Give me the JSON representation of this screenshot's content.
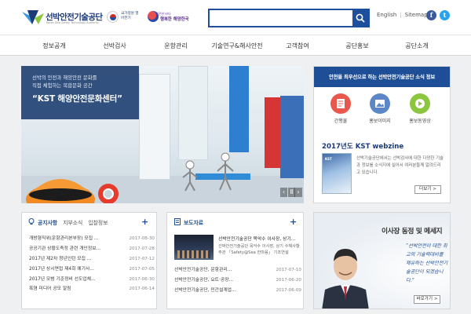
{
  "header": {
    "logo_title": "선박안전기술공단",
    "logo_subtitle": "Korea Ship Safety Technology Authority",
    "flag_text": "국가정원 열어한기",
    "slogan_small": "안전한 바다",
    "slogan_text": "행복한 해양한국",
    "search_placeholder": "",
    "utility": {
      "english": "English",
      "sitemap": "Sitemap"
    },
    "sns": {
      "facebook": "f",
      "twitter": "t"
    }
  },
  "nav": {
    "items": [
      "정보공개",
      "선박검사",
      "운항관리",
      "기술연구&해사안전",
      "고객참여",
      "공단홍보",
      "공단소개"
    ]
  },
  "hero": {
    "line1": "선박의 안전과 해양안전 문화를",
    "line2": "직접 체험하는 복합문화 공간",
    "title": "“KST 해양안전문화센터”",
    "controls": {
      "prev": "‹",
      "pause": "Ⅱ",
      "next": "›"
    }
  },
  "news_panel": {
    "heading": "안전을 최우선으로 하는 선박안전기술공단 소식 정보",
    "icons": [
      {
        "label": "간행물",
        "color": "#e8584c"
      },
      {
        "label": "홍보이미지",
        "color": "#5b86c8"
      },
      {
        "label": "홍보동영상",
        "color": "#8cc63f"
      }
    ],
    "webzine_title": "2017년도 KST webzine",
    "webzine_cover": "KST",
    "webzine_desc": "선박기술공단에서는 선박검사에 대한 다양한 기술과 정보를 소식지에 실어서 여러분들께 알려드리고 있습니다.",
    "more_label": "더보기 >"
  },
  "notice": {
    "tab_active": "공지사항",
    "tab_2": "지부소식",
    "tab_3": "입찰정보",
    "plus": "+",
    "items": [
      {
        "title": "개방형직위(운항관리본부장) 모집 ...",
        "date": "2017-08-30"
      },
      {
        "title": "공공기관 상황도측정 관련 개인정보...",
        "date": "2017-07-28"
      },
      {
        "title": "2017년 제2차 청년인턴 모집 ...",
        "date": "2017-07-12"
      },
      {
        "title": "2017년 상시면접 제4회 예기사...",
        "date": "2017-07-05"
      },
      {
        "title": "2017년 모범 기준정비 선도업체...",
        "date": "2017-06-30"
      },
      {
        "title": "폭염 미디어 공모 알림",
        "date": "2017-06-14"
      }
    ]
  },
  "press": {
    "tab_active": "보도자료",
    "plus": "+",
    "headline": "선박안전기술공단 목악수 이사장, 상기...",
    "desc": "선박안전기술공단 목악수 이사장, 상기 수해사항 주관 「Safety@Sea 한마음」 기조연설",
    "items": [
      {
        "title": "선박안전기술공단, 운항관리...",
        "date": "2017-07-10"
      },
      {
        "title": "선박안전기술공단, 요트·공장...",
        "date": "2017-06-20"
      },
      {
        "title": "선박안전기술공단, 민간설계업...",
        "date": "2017-06-09"
      }
    ]
  },
  "ceo": {
    "title": "이사장 동정 및 메세지",
    "quote": "“선박안전이 대한 최고의 기술력대비를 제유하는 선박안전기술공단이 되겠습니다.”",
    "button": "바로가기 >"
  }
}
